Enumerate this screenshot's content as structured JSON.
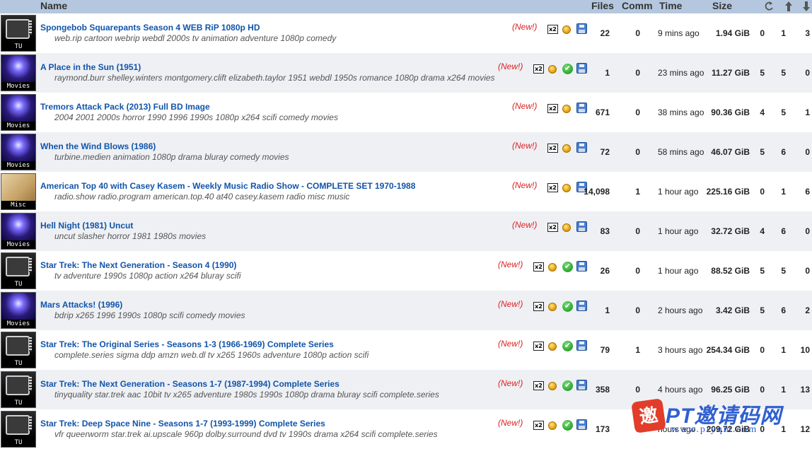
{
  "header": {
    "name": "Name",
    "files": "Files",
    "comm": "Comm",
    "time": "Time",
    "size": "Size",
    "sort_icons": [
      "refresh-icon",
      "arrow-up-icon",
      "arrow-down-icon"
    ]
  },
  "icons": {
    "nzb_label": "x2",
    "check_glyph": "✔"
  },
  "colors": {
    "header_bg": "#b4c7de",
    "title_link": "#1155aa",
    "new_badge": "#d22222",
    "row_alt": "#eef0f4"
  },
  "rows": [
    {
      "category": "TU",
      "cat_class": "cat-tv",
      "title": "Spongebob Squarepants Season 4 WEB RiP 1080p HD",
      "tags": "web.rip cartoon webrip webdl 2000s tv animation adventure 1080p comedy",
      "new": "(New!)",
      "has_check": false,
      "files": "22",
      "comm": "0",
      "time": "9 mins ago",
      "size": "1.94 GiB",
      "s1": "0",
      "s2": "1",
      "s3": "3"
    },
    {
      "category": "Movies",
      "cat_class": "cat-movies",
      "title": "A Place in the Sun (1951)",
      "tags": "raymond.burr shelley.winters montgomery.clift elizabeth.taylor 1951 webdl 1950s romance 1080p drama x264 movies",
      "new": "(New!)",
      "has_check": true,
      "files": "1",
      "comm": "0",
      "time": "23 mins ago",
      "size": "11.27 GiB",
      "s1": "5",
      "s2": "5",
      "s3": "0"
    },
    {
      "category": "Movies",
      "cat_class": "cat-movies",
      "title": "Tremors Attack Pack (2013) Full BD Image",
      "tags": "2004 2001 2000s horror 1990 1996 1990s 1080p x264 scifi comedy movies",
      "new": "(New!)",
      "has_check": false,
      "files": "671",
      "comm": "0",
      "time": "38 mins ago",
      "size": "90.36 GiB",
      "s1": "4",
      "s2": "5",
      "s3": "1"
    },
    {
      "category": "Movies",
      "cat_class": "cat-movies",
      "title": "When the Wind Blows (1986)",
      "tags": "turbine.medien animation 1080p drama bluray comedy movies",
      "new": "(New!)",
      "has_check": false,
      "files": "72",
      "comm": "0",
      "time": "58 mins ago",
      "size": "46.07 GiB",
      "s1": "5",
      "s2": "6",
      "s3": "0"
    },
    {
      "category": "Misc",
      "cat_class": "cat-misc",
      "title": "American Top 40 with Casey Kasem - Weekly Music Radio Show - COMPLETE SET 1970-1988",
      "tags": "radio.show radio.program american.top.40 at40 casey.kasem radio misc music",
      "new": "(New!)",
      "has_check": false,
      "files": "14,098",
      "comm": "1",
      "time": "1 hour ago",
      "size": "225.16 GiB",
      "s1": "0",
      "s2": "1",
      "s3": "6"
    },
    {
      "category": "Movies",
      "cat_class": "cat-movies",
      "title": "Hell Night (1981) Uncut",
      "tags": "uncut slasher horror 1981 1980s movies",
      "new": "(New!)",
      "has_check": false,
      "files": "83",
      "comm": "0",
      "time": "1 hour ago",
      "size": "32.72 GiB",
      "s1": "4",
      "s2": "6",
      "s3": "0"
    },
    {
      "category": "TU",
      "cat_class": "cat-tv",
      "title": "Star Trek: The Next Generation - Season 4 (1990)",
      "tags": "tv adventure 1990s 1080p action x264 bluray scifi",
      "new": "(New!)",
      "has_check": true,
      "files": "26",
      "comm": "0",
      "time": "1 hour ago",
      "size": "88.52 GiB",
      "s1": "5",
      "s2": "5",
      "s3": "0"
    },
    {
      "category": "Movies",
      "cat_class": "cat-movies",
      "title": "Mars Attacks! (1996)",
      "tags": "bdrip x265 1996 1990s 1080p scifi comedy movies",
      "new": "(New!)",
      "has_check": true,
      "files": "1",
      "comm": "0",
      "time": "2 hours ago",
      "size": "3.42 GiB",
      "s1": "5",
      "s2": "6",
      "s3": "2"
    },
    {
      "category": "TU",
      "cat_class": "cat-tv",
      "title": "Star Trek: The Original Series - Seasons 1-3 (1966-1969) Complete Series",
      "tags": "complete.series sigma ddp amzn web.dl tv x265 1960s adventure 1080p action scifi",
      "new": "(New!)",
      "has_check": true,
      "files": "79",
      "comm": "1",
      "time": "3 hours ago",
      "size": "254.34 GiB",
      "s1": "0",
      "s2": "1",
      "s3": "10"
    },
    {
      "category": "TU",
      "cat_class": "cat-tv",
      "title": "Star Trek: The Next Generation - Seasons 1-7 (1987-1994) Complete Series",
      "tags": "tinyquality star.trek aac 10bit tv x265 adventure 1980s 1990s 1080p drama bluray scifi complete.series",
      "new": "(New!)",
      "has_check": true,
      "files": "358",
      "comm": "0",
      "time": "4 hours ago",
      "size": "96.25 GiB",
      "s1": "0",
      "s2": "1",
      "s3": "13"
    },
    {
      "category": "TU",
      "cat_class": "cat-tv",
      "title": "Star Trek: Deep Space Nine - Seasons 1-7 (1993-1999) Complete Series",
      "tags": "vfr queerworm star.trek ai.upscale 960p dolby.surround dvd tv 1990s drama x264 scifi complete.series",
      "new": "(New!)",
      "has_check": true,
      "files": "173",
      "comm": "0",
      "time": "hours ago",
      "size": "209.72 GiB",
      "s1": "0",
      "s2": "1",
      "s3": "12"
    }
  ],
  "watermark": {
    "badge": "邀",
    "text": "PT邀请码网",
    "url": "www.ptyqm.com"
  }
}
